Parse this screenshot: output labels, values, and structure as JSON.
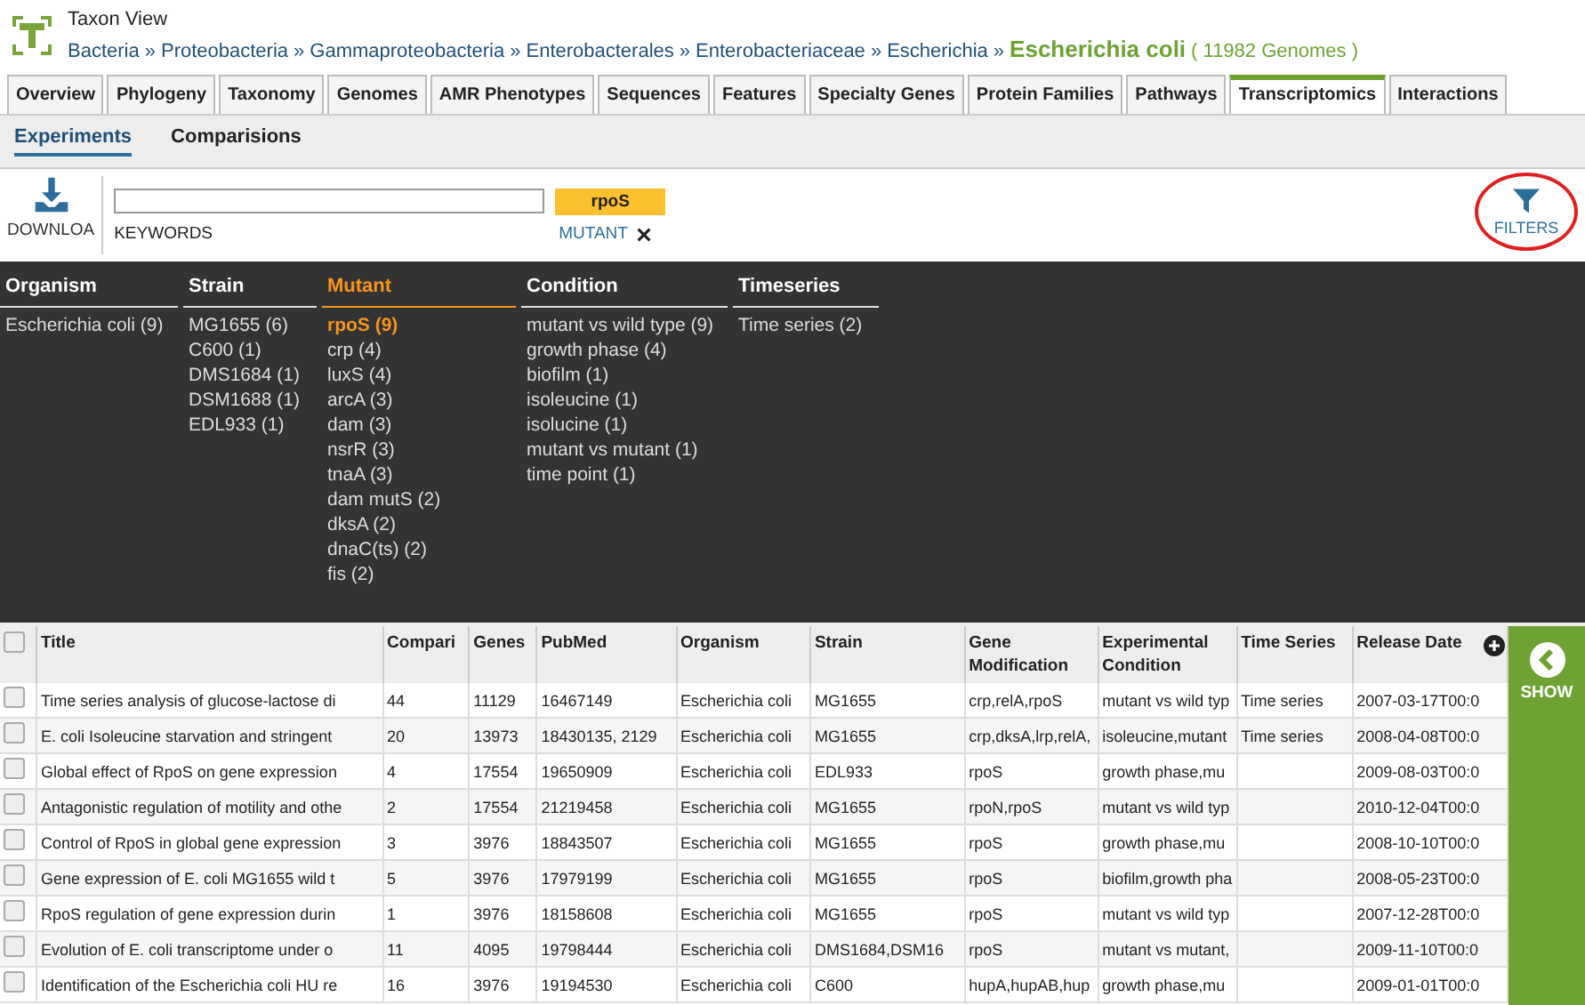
{
  "header": {
    "view_label": "Taxon View",
    "breadcrumb": [
      "Bacteria",
      "Proteobacteria",
      "Gammaproteobacteria",
      "Enterobacterales",
      "Enterobacteriaceae",
      "Escherichia"
    ],
    "separator": "»",
    "taxon": "Escherichia coli",
    "genome_count": "( 11982 Genomes )"
  },
  "tabs": [
    {
      "label": "Overview",
      "selected": false
    },
    {
      "label": "Phylogeny",
      "selected": false
    },
    {
      "label": "Taxonomy",
      "selected": false
    },
    {
      "label": "Genomes",
      "selected": false
    },
    {
      "label": "AMR Phenotypes",
      "selected": false
    },
    {
      "label": "Sequences",
      "selected": false
    },
    {
      "label": "Features",
      "selected": false
    },
    {
      "label": "Specialty Genes",
      "selected": false
    },
    {
      "label": "Protein Families",
      "selected": false
    },
    {
      "label": "Pathways",
      "selected": false
    },
    {
      "label": "Transcriptomics",
      "selected": true
    },
    {
      "label": "Interactions",
      "selected": false
    }
  ],
  "subtabs": [
    {
      "label": "Experiments",
      "selected": true
    },
    {
      "label": "Comparisions",
      "selected": false
    }
  ],
  "toolbar": {
    "download": "DOWNLOA",
    "keywords_label": "KEYWORDS",
    "filter_chip": "rpoS",
    "filter_label": "MUTANT",
    "filters": "FILTERS"
  },
  "filter_groups": [
    {
      "title": "Organism",
      "selected": false,
      "items": [
        {
          "label": "Escherichia coli (9)",
          "selected": false
        }
      ]
    },
    {
      "title": "Strain",
      "selected": false,
      "items": [
        {
          "label": "MG1655 (6)",
          "selected": false
        },
        {
          "label": "C600 (1)",
          "selected": false
        },
        {
          "label": "DMS1684 (1)",
          "selected": false
        },
        {
          "label": "DSM1688 (1)",
          "selected": false
        },
        {
          "label": "EDL933 (1)",
          "selected": false
        }
      ]
    },
    {
      "title": "Mutant",
      "selected": true,
      "items": [
        {
          "label": "rpoS (9)",
          "selected": true
        },
        {
          "label": "crp (4)",
          "selected": false
        },
        {
          "label": "luxS (4)",
          "selected": false
        },
        {
          "label": "arcA (3)",
          "selected": false
        },
        {
          "label": "dam (3)",
          "selected": false
        },
        {
          "label": "nsrR (3)",
          "selected": false
        },
        {
          "label": "tnaA (3)",
          "selected": false
        },
        {
          "label": "dam mutS (2)",
          "selected": false
        },
        {
          "label": "dksA (2)",
          "selected": false
        },
        {
          "label": "dnaC(ts) (2)",
          "selected": false
        },
        {
          "label": "fis (2)",
          "selected": false
        }
      ]
    },
    {
      "title": "Condition",
      "selected": false,
      "items": [
        {
          "label": "mutant vs wild type (9)",
          "selected": false
        },
        {
          "label": "growth phase (4)",
          "selected": false
        },
        {
          "label": "biofilm (1)",
          "selected": false
        },
        {
          "label": "isoleucine (1)",
          "selected": false
        },
        {
          "label": "isolucine (1)",
          "selected": false
        },
        {
          "label": "mutant vs mutant (1)",
          "selected": false
        },
        {
          "label": "time point (1)",
          "selected": false
        }
      ]
    },
    {
      "title": "Timeseries",
      "selected": false,
      "items": [
        {
          "label": "Time series (2)",
          "selected": false
        }
      ]
    }
  ],
  "table": {
    "select_all_checked": false,
    "columns": [
      "Title",
      "Compari",
      "Genes",
      "PubMed",
      "Organism",
      "Strain",
      "Gene Modification",
      "Experimental Condition",
      "Time Series",
      "Release Date"
    ],
    "rows": [
      {
        "checked": false,
        "cells": [
          "Time series analysis of glucose-lactose di",
          "44",
          "11129",
          "16467149",
          "Escherichia coli",
          "MG1655",
          "crp,relA,rpoS",
          "mutant vs wild typ",
          "Time series",
          "2007-03-17T00:0"
        ]
      },
      {
        "checked": false,
        "cells": [
          "E. coli Isoleucine starvation and stringent",
          "20",
          "13973",
          "18430135, 2129",
          "Escherichia coli",
          "MG1655",
          "crp,dksA,lrp,relA,",
          "isoleucine,mutant",
          "Time series",
          "2008-04-08T00:0"
        ]
      },
      {
        "checked": false,
        "cells": [
          "Global effect of RpoS on gene expression",
          "4",
          "17554",
          "19650909",
          "Escherichia coli",
          "EDL933",
          "rpoS",
          "growth phase,mu",
          "",
          "2009-08-03T00:0"
        ]
      },
      {
        "checked": false,
        "cells": [
          "Antagonistic regulation of motility and othe",
          "2",
          "17554",
          "21219458",
          "Escherichia coli",
          "MG1655",
          "rpoN,rpoS",
          "mutant vs wild typ",
          "",
          "2010-12-04T00:0"
        ]
      },
      {
        "checked": false,
        "cells": [
          "Control of RpoS in global gene expression",
          "3",
          "3976",
          "18843507",
          "Escherichia coli",
          "MG1655",
          "rpoS",
          "growth phase,mu",
          "",
          "2008-10-10T00:0"
        ]
      },
      {
        "checked": false,
        "cells": [
          "Gene expression of E. coli MG1655 wild t",
          "5",
          "3976",
          "17979199",
          "Escherichia coli",
          "MG1655",
          "rpoS",
          "biofilm,growth pha",
          "",
          "2008-05-23T00:0"
        ]
      },
      {
        "checked": false,
        "cells": [
          "RpoS regulation of gene expression durin",
          "1",
          "3976",
          "18158608",
          "Escherichia coli",
          "MG1655",
          "rpoS",
          "mutant vs wild typ",
          "",
          "2007-12-28T00:0"
        ]
      },
      {
        "checked": false,
        "cells": [
          "Evolution of E. coli transcriptome under o",
          "11",
          "4095",
          "19798444",
          "Escherichia coli",
          "DMS1684,DSM16",
          "rpoS",
          "mutant vs mutant,",
          "",
          "2009-11-10T00:0"
        ]
      },
      {
        "checked": false,
        "cells": [
          "Identification of the Escherichia coli HU re",
          "16",
          "3976",
          "19194530",
          "Escherichia coli",
          "C600",
          "hupA,hupAB,hup",
          "growth phase,mu",
          "",
          "2009-01-01T00:0"
        ]
      }
    ]
  },
  "side_panel": {
    "label": "SHOW"
  }
}
